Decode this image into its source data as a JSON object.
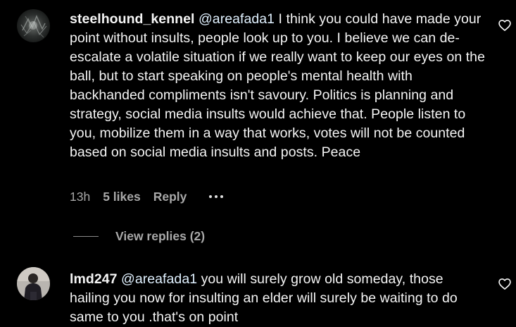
{
  "comments": [
    {
      "username": "steelhound_kennel",
      "mention": "@areafada1",
      "text": " I think you could have made your point without insults, people look up to you. I believe we can de-escalate a volatile situation if we really want to keep our eyes on the ball, but to start speaking on people's mental health with backhanded compliments isn't savoury. Politics is planning and strategy, social media insults would achieve that. People listen to you, mobilize them in a way that works, votes will not be counted based on social media insults and posts. Peace",
      "time": "13h",
      "likes": "5 likes",
      "reply_label": "Reply",
      "view_replies": "View replies (2)",
      "avatar_icon": "dark-textured-avatar"
    },
    {
      "username": "lmd247",
      "mention": "@areafada1",
      "text": " you will surely grow old someday, those hailing you now for insulting an elder will surely be waiting to do same to you .that's on point",
      "avatar_icon": "person-photo-avatar"
    }
  ],
  "icons": {
    "like": "heart-outline-icon",
    "more": "more-options-icon"
  },
  "colors": {
    "background": "#000000",
    "text": "#f5f5f5",
    "secondary": "#a8a8a8",
    "mention": "#e0f1ff"
  }
}
